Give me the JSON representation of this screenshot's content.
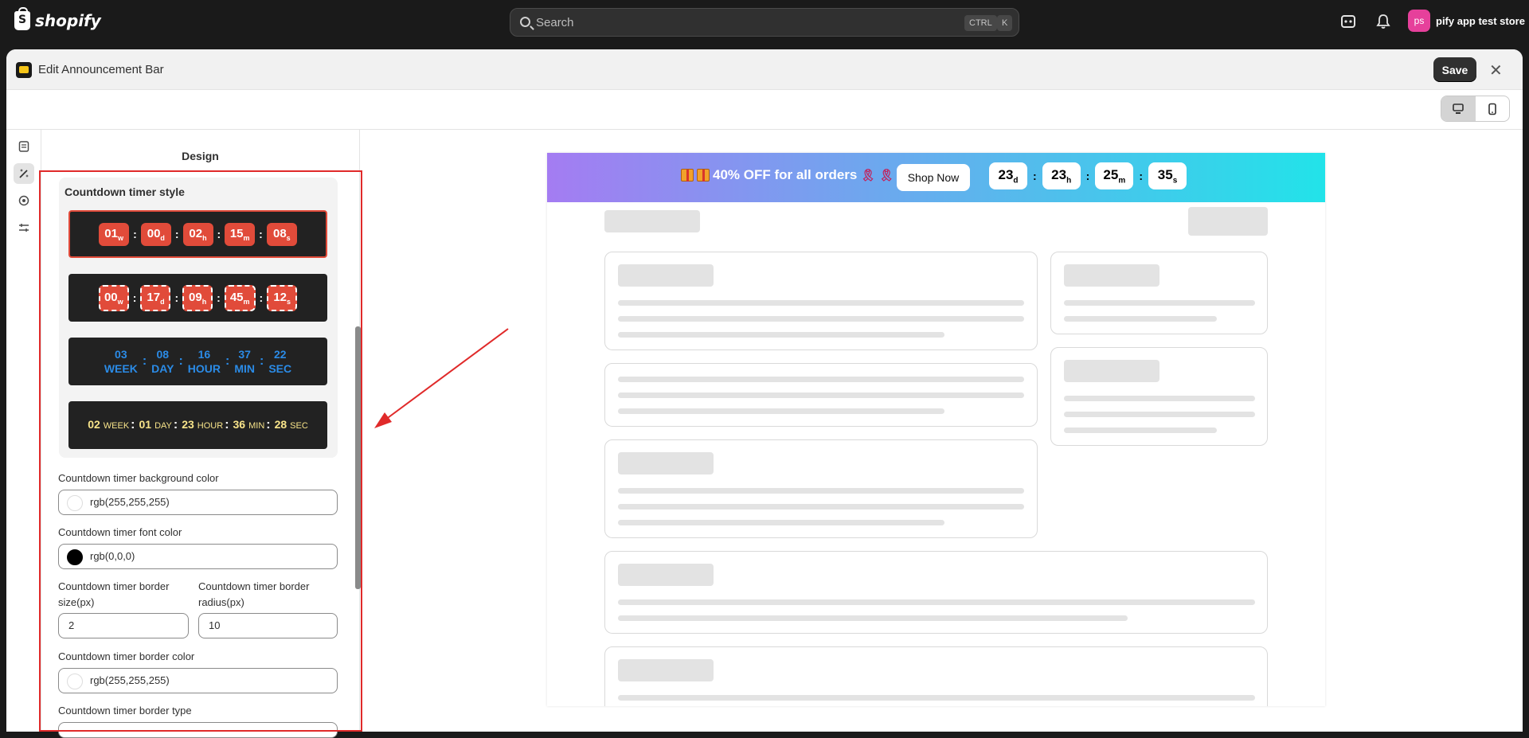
{
  "topbar": {
    "brand": "shopify",
    "search_placeholder": "Search",
    "kbd_ctrl": "CTRL",
    "kbd_k": "K",
    "store_initials": "ps",
    "store_name": "pify app test store"
  },
  "modal": {
    "title": "Edit Announcement Bar",
    "save_label": "Save",
    "close_label": "✕"
  },
  "panel": {
    "title": "Design",
    "countdown_style_title": "Countdown timer style",
    "style1": {
      "w": "01",
      "d": "00",
      "h": "02",
      "m": "15",
      "s": "08"
    },
    "style2": {
      "w": "00",
      "d": "17",
      "h": "09",
      "m": "45",
      "s": "12"
    },
    "style3": {
      "w": "03",
      "d": "08",
      "h": "16",
      "m": "37",
      "s": "22",
      "lw": "WEEK",
      "ld": "DAY",
      "lh": "HOUR",
      "lm": "MIN",
      "ls": "SEC"
    },
    "style4": {
      "w": "02",
      "d": "01",
      "h": "23",
      "m": "36",
      "s": "28",
      "lw": "WEEK",
      "ld": "DAY",
      "lh": "HOUR",
      "lm": "MIN",
      "ls": "SEC"
    },
    "unit_w": "w",
    "unit_d": "d",
    "unit_h": "h",
    "unit_m": "m",
    "unit_s": "s",
    "bg_label": "Countdown timer background color",
    "bg_value": "rgb(255,255,255)",
    "font_label": "Countdown timer font color",
    "font_value": "rgb(0,0,0)",
    "border_size_label": "Countdown timer border size(px)",
    "border_size_value": "2",
    "border_radius_label": "Countdown timer border radius(px)",
    "border_radius_value": "10",
    "border_color_label": "Countdown timer border color",
    "border_color_value": "rgb(255,255,255)",
    "border_type_label": "Countdown timer border type"
  },
  "preview": {
    "offer_text": "40% OFF for all orders",
    "shop_now": "Shop Now",
    "timer": {
      "d": "23",
      "h": "23",
      "m": "25",
      "s": "35"
    }
  },
  "colors": {
    "accent_red": "#e14b3a",
    "highlight_red": "#e02a2a",
    "gradient_start": "#a47cf2",
    "gradient_end": "#22e3e9"
  }
}
